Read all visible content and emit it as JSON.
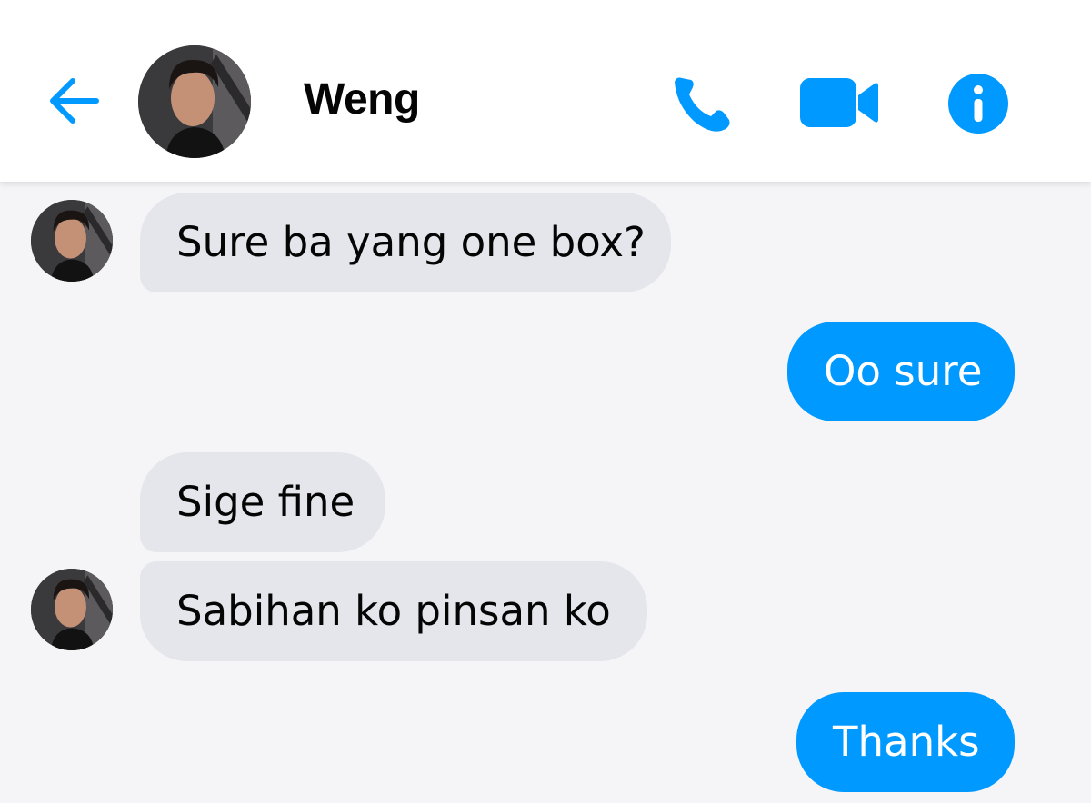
{
  "header": {
    "contact_name": "Weng",
    "back_icon": "arrow-left-icon",
    "call_icon": "phone-icon",
    "video_icon": "video-camera-icon",
    "info_icon": "info-icon"
  },
  "colors": {
    "accent": "#0099ff",
    "incoming_bubble": "#e4e6eb",
    "background": "#f5f5f7"
  },
  "messages": [
    {
      "direction": "incoming",
      "text": "Sure ba yang one box?"
    },
    {
      "direction": "outgoing",
      "text": "Oo sure"
    },
    {
      "direction": "incoming",
      "text": "Sige fine"
    },
    {
      "direction": "incoming",
      "text": "Sabihan ko pinsan ko"
    },
    {
      "direction": "outgoing",
      "text": "Thanks"
    }
  ]
}
